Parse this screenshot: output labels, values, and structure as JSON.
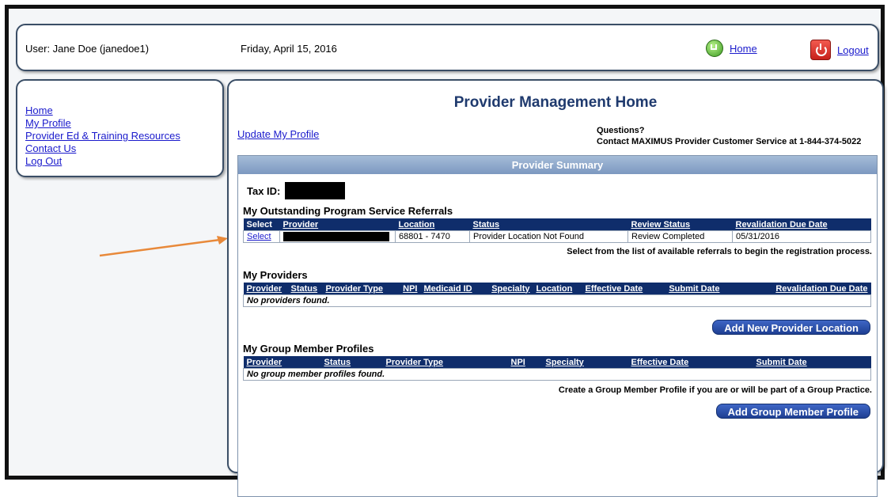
{
  "header": {
    "user": "User: Jane Doe (janedoe1)",
    "date": "Friday, April 15, 2016",
    "home_label": "Home",
    "logout_label": "Logout"
  },
  "sidebar": {
    "items": [
      {
        "label": "Home"
      },
      {
        "label": "My Profile"
      },
      {
        "label": "Provider Ed & Training Resources"
      },
      {
        "label": "Contact Us"
      },
      {
        "label": "Log Out"
      }
    ]
  },
  "main": {
    "title": "Provider Management Home",
    "update_profile": "Update My Profile",
    "questions_line1": "Questions?",
    "questions_line2": "Contact MAXIMUS Provider Customer Service at 1-844-374-5022",
    "summary_title": "Provider Summary",
    "tax_id_label": "Tax ID:",
    "referrals": {
      "title": "My Outstanding Program Service Referrals",
      "columns": [
        "Select",
        "Provider",
        "Location",
        "Status",
        "Review Status",
        "Revalidation Due Date"
      ],
      "row": {
        "select": "Select",
        "location": "68801 - 7470",
        "status": "Provider Location Not Found",
        "review_status": "Review Completed",
        "due_date": "05/31/2016"
      },
      "note": "Select from the list of available referrals to begin the registration process."
    },
    "providers": {
      "title": "My Providers",
      "columns": [
        "Provider",
        "Status",
        "Provider Type",
        "NPI",
        "Medicaid ID",
        "Specialty",
        "Location",
        "Effective Date",
        "Submit Date",
        "Revalidation Due Date"
      ],
      "empty": "No providers found.",
      "button": "Add New Provider Location"
    },
    "group": {
      "title": "My Group Member Profiles",
      "columns": [
        "Provider",
        "Status",
        "Provider Type",
        "NPI",
        "Specialty",
        "Effective Date",
        "Submit Date"
      ],
      "empty": "No group member profiles found.",
      "note": "Create a Group Member Profile if you are or will be part of a Group Practice.",
      "button": "Add Group Member Profile"
    }
  },
  "colors": {
    "header_bg": "#0f2d6b",
    "title": "#1f3a6e",
    "link": "#1a1acc",
    "arrow": "#e8893a"
  }
}
